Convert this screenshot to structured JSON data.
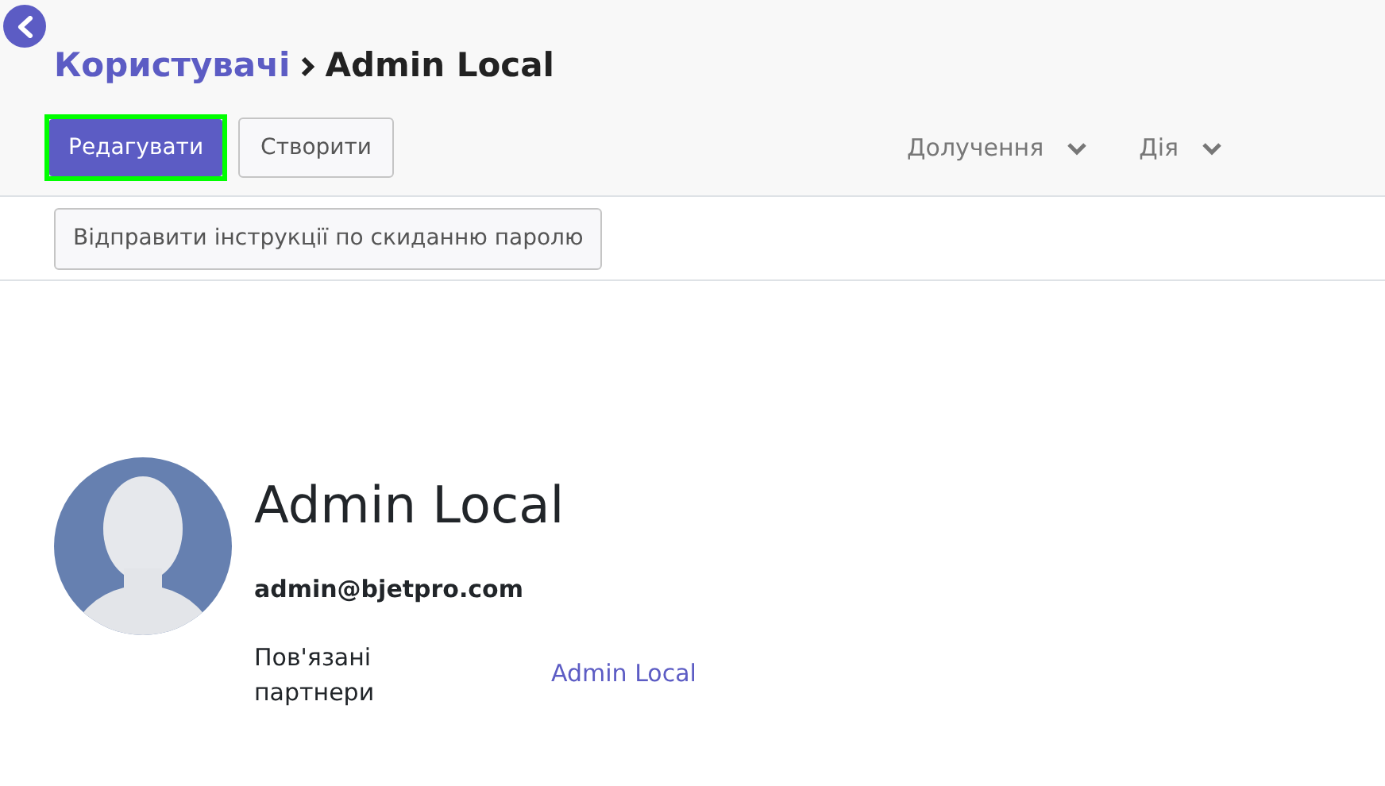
{
  "breadcrumb": [
    {
      "label": "Користувачі",
      "kind": "link"
    },
    {
      "label": "Admin Local",
      "kind": "current"
    }
  ],
  "buttons": [
    {
      "label": "Редагувати",
      "kind": "primary",
      "focused": true
    },
    {
      "label": "Створити",
      "kind": "secondary",
      "focused": false
    }
  ],
  "dropdowns": [
    {
      "label": "Долучення"
    },
    {
      "label": "Дія"
    }
  ],
  "status_buttons": [
    {
      "label": "Відправити інструкції по скиданню паролю"
    }
  ],
  "record": {
    "name": "Admin Local",
    "email": "admin@bjetpro.com",
    "fields": [
      {
        "label": "Пов'язані партнери",
        "value": "Admin Local"
      }
    ]
  }
}
